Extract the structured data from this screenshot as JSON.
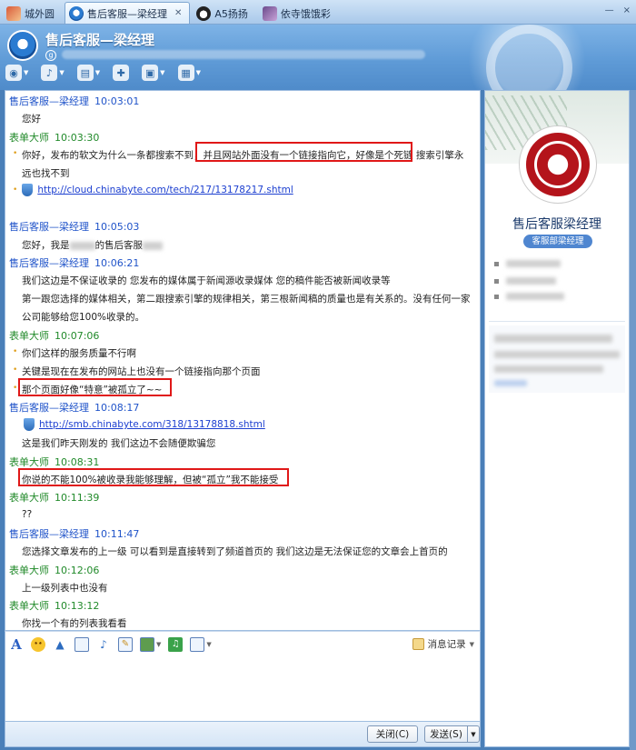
{
  "tabs": [
    {
      "label": "城外圆",
      "icon": "avatar-icon",
      "active": false,
      "closable": false
    },
    {
      "label": "售后客服—梁经理",
      "icon": "qq-icon",
      "active": true,
      "closable": true
    },
    {
      "label": "A5扬扬",
      "icon": "panda-icon",
      "active": false,
      "closable": false
    },
    {
      "label": "依寺饿饿彩",
      "icon": "avatar-icon",
      "active": false,
      "closable": false
    }
  ],
  "window_controls": {
    "minimize": "—",
    "close": "×"
  },
  "header": {
    "title": "售后客服—梁经理",
    "signature_icon": "g"
  },
  "toolbar": [
    {
      "name": "video-call",
      "glyph": "◉"
    },
    {
      "name": "voice-call",
      "glyph": "♪"
    },
    {
      "name": "send-file",
      "glyph": "▤"
    },
    {
      "name": "create-discussion",
      "glyph": "✚"
    },
    {
      "name": "remote-assist",
      "glyph": "▣"
    },
    {
      "name": "apps",
      "glyph": "▦"
    }
  ],
  "chat": {
    "messages": [
      {
        "sender": "售后客服—梁经理",
        "role": "staff",
        "time": "10:03:01"
      },
      {
        "sender": "表单大师",
        "role": "user",
        "time": "10:03:30"
      },
      {
        "sender": "售后客服—梁经理",
        "role": "staff",
        "time": "10:05:03"
      },
      {
        "sender": "售后客服—梁经理",
        "role": "staff",
        "time": "10:06:21"
      },
      {
        "sender": "表单大师",
        "role": "user",
        "time": "10:07:06"
      },
      {
        "sender": "售后客服—梁经理",
        "role": "staff",
        "time": "10:08:17"
      },
      {
        "sender": "表单大师",
        "role": "user",
        "time": "10:08:31"
      },
      {
        "sender": "表单大师",
        "role": "user",
        "time": "10:11:39"
      },
      {
        "sender": "售后客服—梁经理",
        "role": "staff",
        "time": "10:11:47"
      },
      {
        "sender": "表单大师",
        "role": "user",
        "time": "10:12:06"
      },
      {
        "sender": "表单大师",
        "role": "user",
        "time": "10:13:12"
      }
    ],
    "text": {
      "m1": "您好",
      "m2a": "你好，发布的软文为什么一条都搜索不到，",
      "m2b": "并且网站外面没有一个链接指向它，好像是个死链",
      "m2c": "搜索引擎永",
      "m2d": "远也找不到",
      "m2link": "http://cloud.chinabyte.com/tech/217/13178217.shtml",
      "m3a": "您好，我是",
      "m3b": "的售后客服",
      "m4a": "我们这边是不保证收录的   您发布的媒体属于新闻源收录媒体    您的稿件能否被新闻收录等",
      "m4b": "第一跟您选择的媒体相关，第二跟搜索引擎的规律相关，第三根新闻稿的质量也是有关系的。没有任何一家",
      "m4c": "公司能够给您100%收录的。",
      "m5a": "你们这样的服务质量不行啊",
      "m5b": "关键是现在在发布的网站上也没有一个链接指向那个页面",
      "m5c": "那个页面好像“特意”被孤立了~~",
      "m6link": "http://smb.chinabyte.com/318/13178818.shtml",
      "m6b": "这是我们昨天刚发的   我们这边不会随便欺骗您",
      "m7": "你说的不能100%被收录我能够理解，但被“孤立”我不能接受",
      "m8": "??",
      "m9": "您选择文章发布的上一级  可以看到是直接转到了频道首页的   我们这边是无法保证您的文章会上首页的",
      "m10": "上一级列表中也没有",
      "m11": "你找一个有的列表我看看"
    }
  },
  "input_toolbar": {
    "history_label": "消息记录"
  },
  "buttons": {
    "close": "关闭(C)",
    "send": "发送(S)"
  },
  "side": {
    "name": "售后客服梁经理",
    "dept": "客服部梁经理"
  },
  "colors": {
    "staff_name": "#1f53c9",
    "user_name": "#218a2a",
    "highlight_box": "#e01818",
    "link": "#1c3fd0"
  }
}
